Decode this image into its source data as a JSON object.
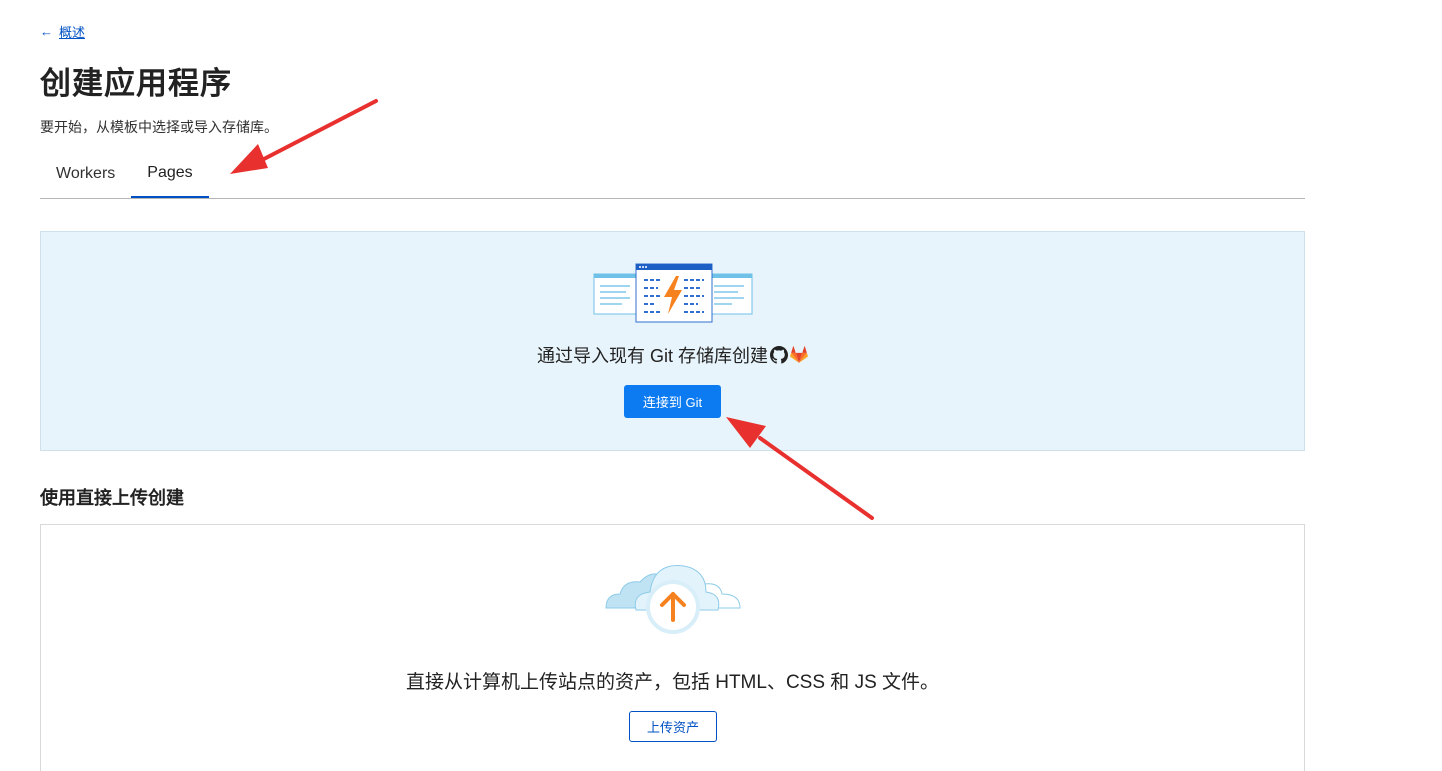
{
  "nav": {
    "back_label": "概述"
  },
  "header": {
    "title": "创建应用程序",
    "subtitle": "要开始，从模板中选择或导入存储库。"
  },
  "tabs": [
    {
      "label": "Workers",
      "active": false
    },
    {
      "label": "Pages",
      "active": true
    }
  ],
  "git_section": {
    "text": "通过导入现有 Git 存储库创建",
    "icons": [
      "github-icon",
      "gitlab-icon"
    ],
    "button_label": "连接到 Git"
  },
  "upload_section": {
    "title": "使用直接上传创建",
    "text": "直接从计算机上传站点的资产，包括 HTML、CSS 和 JS 文件。",
    "button_label": "上传资产"
  },
  "colors": {
    "primary": "#0c7bf2",
    "link": "#0051c3",
    "git_panel_bg": "#e8f4fb",
    "annotation_arrow": "#e8312f",
    "accent_orange": "#f6821f"
  }
}
